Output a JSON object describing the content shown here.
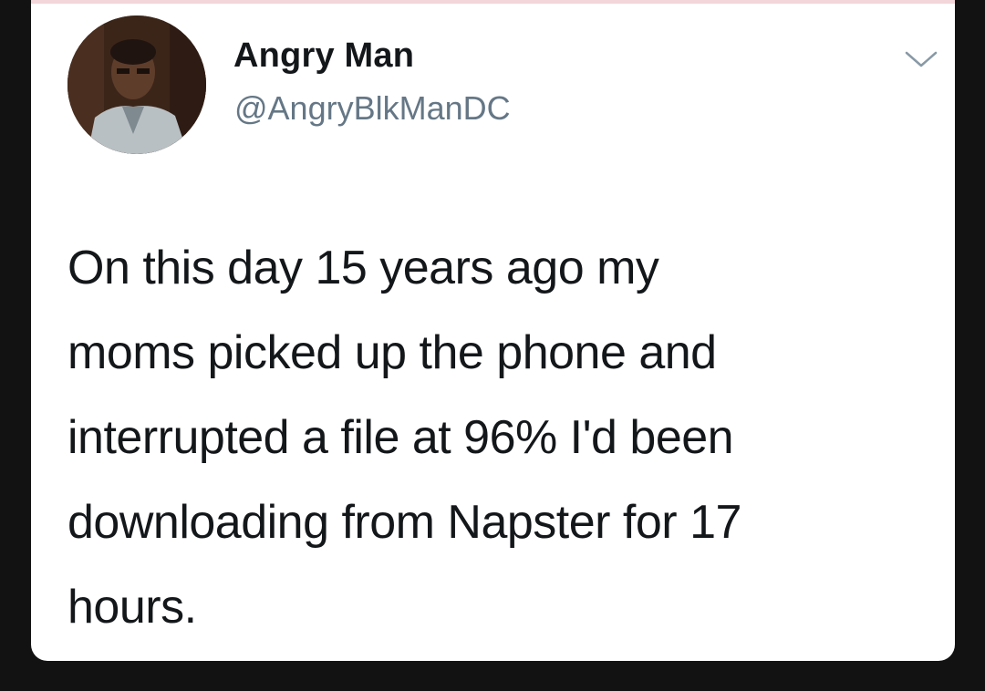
{
  "tweet": {
    "author": {
      "name": "Angry Man",
      "handle": "@AngryBlkManDC"
    },
    "text_lines": [
      "On this day 15 years ago my",
      "moms picked up the phone and",
      "interrupted a file at 96% I'd been",
      "downloading from Napster for 17",
      "hours."
    ],
    "menu_icon": "chevron-down-icon"
  },
  "colors": {
    "page_background": "#121212",
    "card_background": "#ffffff",
    "name_color": "#14171a",
    "handle_color": "#657786"
  }
}
